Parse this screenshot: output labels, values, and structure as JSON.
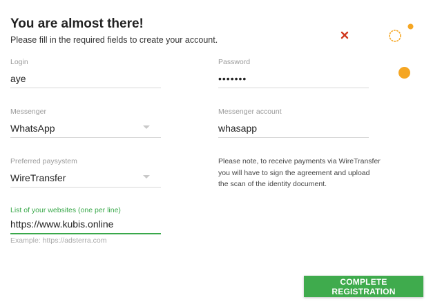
{
  "header": {
    "title": "You are almost there!",
    "subtitle": "Please fill in the required fields to create your account."
  },
  "form": {
    "login": {
      "label": "Login",
      "value": "aye"
    },
    "password": {
      "label": "Password",
      "value": "•••••••"
    },
    "messenger": {
      "label": "Messenger",
      "value": "WhatsApp"
    },
    "messenger_account": {
      "label": "Messenger account",
      "value": "whasapp"
    },
    "paysystem": {
      "label": "Preferred paysystem",
      "value": "WireTransfer"
    },
    "websites": {
      "label": "List of your websites (one per line)",
      "value": "https://www.kubis.online",
      "hint": "Example: https://adsterra.com"
    }
  },
  "note": {
    "lines": [
      "Please note, to receive payments via WireTransfer",
      "you will have to sign the agreement and upload",
      "the scan of the identity document."
    ]
  },
  "actions": {
    "submit_label": "COMPLETE REGISTRATION"
  },
  "colors": {
    "accent_green": "#3fab4d",
    "decor_orange": "#f5a623",
    "decor_red": "#d0391f"
  },
  "decorations": [
    "x-mark-icon",
    "dotted-circle-icon",
    "small-dot-icon",
    "large-dot-icon"
  ]
}
